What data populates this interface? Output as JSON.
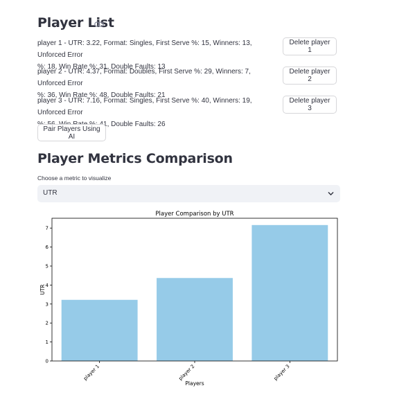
{
  "header": {
    "player_list_title": "Player List",
    "metrics_title": "Player Metrics Comparison"
  },
  "players": [
    {
      "line1": "player 1 - UTR: 3.22, Format: Singles, First Serve %: 15, Winners: 13, Unforced Error",
      "line2": "%: 18, Win Rate %: 31, Double Faults: 13",
      "delete_label": "Delete player 1"
    },
    {
      "line1": "player 2 - UTR: 4.37, Format: Doubles, First Serve %: 29, Winners: 7, Unforced Error",
      "line2": "%: 36, Win Rate %: 48, Double Faults: 21",
      "delete_label": "Delete player 2"
    },
    {
      "line1": "player 3 - UTR: 7.16, Format: Singles, First Serve %: 40, Winners: 19, Unforced Error",
      "line2": "%: 56, Win Rate %: 41, Double Faults: 26",
      "delete_label": "Delete player 3"
    }
  ],
  "pair_button_label": "Pair Players Using AI",
  "metric_select": {
    "label": "Choose a metric to visualize",
    "value": "UTR"
  },
  "colors": {
    "bar": "#96cbe8",
    "text": "#31333f",
    "select_bg": "#f0f2f6"
  },
  "chart_data": {
    "type": "bar",
    "title": "Player Comparison by UTR",
    "xlabel": "Players",
    "ylabel": "UTR",
    "categories": [
      "player 1",
      "player 2",
      "player 3"
    ],
    "values": [
      3.22,
      4.37,
      7.16
    ],
    "ylim": [
      0,
      7.518
    ],
    "yticks": [
      0,
      1,
      2,
      3,
      4,
      5,
      6,
      7
    ],
    "grid": false
  }
}
